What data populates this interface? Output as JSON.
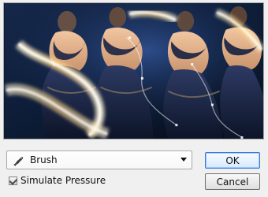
{
  "preview": {
    "image_name": "belly-dancers-photo"
  },
  "brush": {
    "selected": "Brush",
    "icon": "brush-icon"
  },
  "options": {
    "simulate_pressure_label": "Simulate Pressure",
    "simulate_pressure_checked": true
  },
  "buttons": {
    "ok_label": "OK",
    "cancel_label": "Cancel"
  },
  "colors": {
    "background": "#f0f0f0",
    "preview_dark": "#0b1830",
    "accent": "#3b79d6",
    "stroke_glow": "#ffd27a",
    "stroke_white": "#ffffff"
  }
}
